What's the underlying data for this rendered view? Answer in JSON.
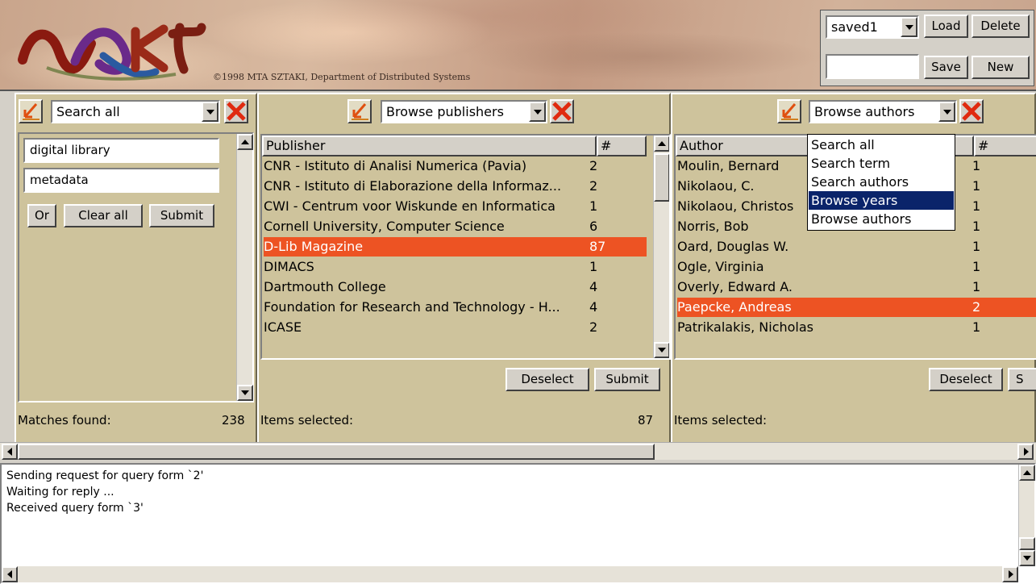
{
  "banner": {
    "logo_text": "NQKI",
    "copyright": "©1998 MTA SZTAKI, Department of Distributed Systems"
  },
  "saved_query": {
    "selected": "saved1",
    "load_label": "Load",
    "delete_label": "Delete",
    "name_value": "",
    "save_label": "Save",
    "new_label": "New"
  },
  "search_panel": {
    "mode": "Search all",
    "terms": [
      "digital library",
      "metadata"
    ],
    "or_label": "Or",
    "clear_label": "Clear all",
    "submit_label": "Submit",
    "status_label": "Matches found:",
    "status_value": "238"
  },
  "publishers_panel": {
    "mode": "Browse publishers",
    "column_name": "Publisher",
    "column_count": "#",
    "rows": [
      {
        "name": "CNR - Istituto di Analisi Numerica (Pavia)",
        "count": "2"
      },
      {
        "name": "CNR - Istituto di Elaborazione della Informaz...",
        "count": "2"
      },
      {
        "name": "CWI - Centrum voor Wiskunde en Informatica",
        "count": "1"
      },
      {
        "name": "Cornell University, Computer Science",
        "count": "6"
      },
      {
        "name": "D-Lib Magazine",
        "count": "87"
      },
      {
        "name": "DIMACS",
        "count": "1"
      },
      {
        "name": "Dartmouth College",
        "count": "4"
      },
      {
        "name": "Foundation for Research and Technology - H...",
        "count": "4"
      },
      {
        "name": "ICASE",
        "count": "2"
      }
    ],
    "selected_row": 4,
    "deselect_label": "Deselect",
    "submit_label": "Submit",
    "status_label": "Items selected:",
    "status_value": "87"
  },
  "authors_panel": {
    "mode": "Browse authors",
    "column_name": "Author",
    "column_count": "#",
    "rows": [
      {
        "name": "Moulin, Bernard",
        "count": "1"
      },
      {
        "name": "Nikolaou, C.",
        "count": "1"
      },
      {
        "name": "Nikolaou, Christos",
        "count": "1"
      },
      {
        "name": "Norris, Bob",
        "count": "1"
      },
      {
        "name": "Oard, Douglas W.",
        "count": "1"
      },
      {
        "name": "Ogle, Virginia",
        "count": "1"
      },
      {
        "name": "Overly, Edward A.",
        "count": "1"
      },
      {
        "name": "Paepcke, Andreas",
        "count": "2"
      },
      {
        "name": "Patrikalakis, Nicholas",
        "count": "1"
      }
    ],
    "selected_row": 7,
    "deselect_label": "Deselect",
    "submit_label_partial": "S",
    "status_label": "Items selected:",
    "dropdown_options": [
      "Search all",
      "Search term",
      "Search authors",
      "Browse years",
      "Browse authors"
    ],
    "dropdown_highlight": 3
  },
  "log": {
    "lines": [
      "Sending request for query form `2'",
      "Waiting for reply ...",
      "Received query form `3'"
    ]
  },
  "colors": {
    "panel_bg": "#cec39c",
    "selection": "#ed5323",
    "dropdown_highlight": "#0a246a"
  }
}
